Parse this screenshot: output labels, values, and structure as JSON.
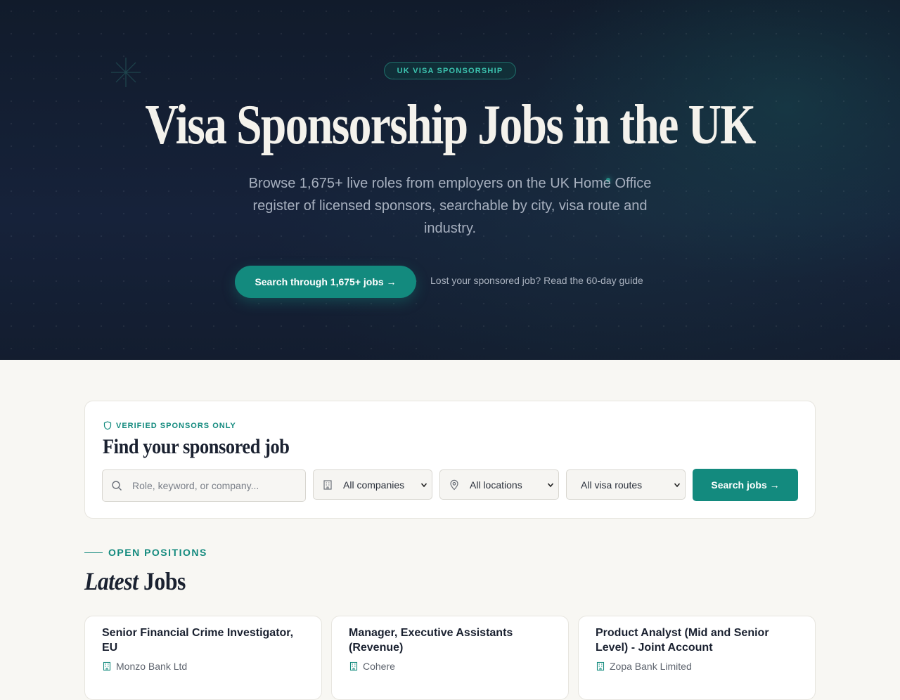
{
  "hero": {
    "badge": "UK VISA SPONSORSHIP",
    "title": "Visa Sponsorship Jobs in the UK",
    "subtitle": "Browse 1,675+ live roles from employers on the UK Home Office register of licensed sponsors, searchable by city, visa route and industry.",
    "cta_label": "Search through 1,675+ jobs →",
    "guide_link": "Lost your sponsored job? Read the 60-day guide"
  },
  "search": {
    "verified_label": "VERIFIED SPONSORS ONLY",
    "title": "Find your sponsored job",
    "keyword_placeholder": "Role, keyword, or company...",
    "company_selected": "All companies",
    "location_selected": "All locations",
    "visa_selected": "All visa routes",
    "button_label": "Search jobs →"
  },
  "jobs_section": {
    "eyebrow": "OPEN POSITIONS",
    "title_italic": "Latest",
    "title_rest": " Jobs",
    "jobs": [
      {
        "title": "Senior Financial Crime Investigator, EU",
        "company": "Monzo Bank Ltd"
      },
      {
        "title": "Manager, Executive Assistants (Revenue)",
        "company": "Cohere"
      },
      {
        "title": "Product Analyst (Mid and Senior Level) - Joint Account",
        "company": "Zopa Bank Limited"
      }
    ]
  },
  "colors": {
    "accent": "#138a7e",
    "hero_bg": "#131d2f",
    "page_bg": "#f8f7f3"
  },
  "icons": {
    "sparkle": "sparkle-icon",
    "shield": "shield-icon",
    "search": "search-icon",
    "building": "building-icon",
    "location": "map-pin-icon",
    "chevron": "chevron-down-icon"
  }
}
